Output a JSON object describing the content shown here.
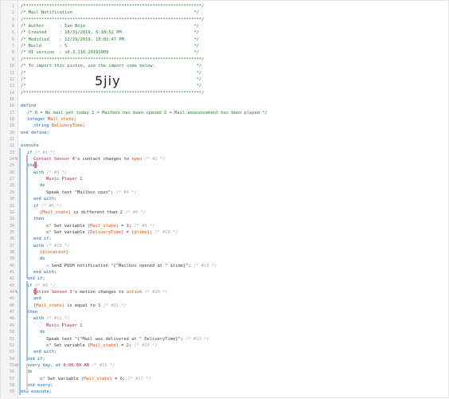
{
  "lines": [
    {
      "n": "1",
      "t": "/*********************************************************************/",
      "c": "cmt",
      "i": 0
    },
    {
      "n": "2",
      "t": "/* Mail Notification                                               */",
      "c": "cmt",
      "i": 0
    },
    {
      "n": "3",
      "t": "/*********************************************************************/",
      "c": "cmt",
      "i": 0
    },
    {
      "n": "4",
      "t": "/* Author      : Ian Boje                                          */",
      "c": "cmt",
      "i": 0
    },
    {
      "n": "5",
      "t": "/* Created     : 10/31/2019, 6:10:52 PM                            */",
      "c": "cmt",
      "i": 0
    },
    {
      "n": "6",
      "t": "/* Modified    : 12/29/2019, 10:02:47 PM                           */",
      "c": "cmt",
      "i": 0
    },
    {
      "n": "7",
      "t": "/* Build       : 5                                                 */",
      "c": "cmt",
      "i": 0
    },
    {
      "n": "8",
      "t": "/* UI version  : v0.3.110.20191009                                 */",
      "c": "cmt",
      "i": 0
    },
    {
      "n": "9",
      "t": "/*********************************************************************/",
      "c": "cmt",
      "i": 0
    },
    {
      "n": "10",
      "t": "/* To import this piston, use the import code below:                */",
      "c": "cmt",
      "i": 0
    },
    {
      "n": "11",
      "t": "/*                                                                  */",
      "c": "cmt",
      "i": 0
    },
    {
      "n": "12",
      "t": "/*                                                                  */",
      "c": "cmt",
      "i": 0
    },
    {
      "n": "13",
      "t": "/*                                                                  */",
      "c": "cmt",
      "i": 0
    },
    {
      "n": "14",
      "t": "/*********************************************************************/",
      "c": "cmt",
      "i": 0
    },
    {
      "n": "15",
      "t": "",
      "c": "",
      "i": 0
    },
    {
      "n": "16",
      "t": "define",
      "c": "kw",
      "i": 0
    },
    {
      "n": "17",
      "t": "/* 0 = No mail yet today 1 = Mailbox has been opened 2 = Mail announcement has been played */",
      "c": "cmt",
      "i": 1
    },
    {
      "n": "18",
      "segs": [
        {
          "t": "integer ",
          "c": "kw"
        },
        {
          "t": "Mail_state",
          "c": "var"
        },
        {
          "t": ";",
          "c": ""
        }
      ],
      "i": 1
    },
    {
      "n": "19",
      "segs": [
        {
          "t": "string ",
          "c": "kw"
        },
        {
          "t": "DeliveryTime",
          "c": "var"
        },
        {
          "t": ";",
          "c": ""
        }
      ],
      "i": 2
    },
    {
      "n": "20",
      "t": "end define;",
      "c": "kw",
      "i": 0
    },
    {
      "n": "21",
      "t": "",
      "c": "",
      "i": 0
    },
    {
      "n": "22",
      "t": "execute",
      "c": "kw",
      "i": 0
    },
    {
      "n": "23",
      "segs": [
        {
          "t": "if ",
          "c": "kw"
        },
        {
          "t": "/* #1 */",
          "c": "dim"
        }
      ],
      "i": 1
    },
    {
      "n": "24",
      "segs": [
        {
          "t": "Contact Sensor 4",
          "c": "dev"
        },
        {
          "t": "'s contact changes to ",
          "c": ""
        },
        {
          "t": "open",
          "c": "var"
        },
        {
          "t": " /* #2 */",
          "c": "dim"
        }
      ],
      "i": 2,
      "mark": "%"
    },
    {
      "n": "25",
      "t": "then",
      "c": "kw",
      "i": 1
    },
    {
      "n": "26",
      "segs": [
        {
          "t": "with ",
          "c": "kw"
        },
        {
          "t": "/* #3 */",
          "c": "dim"
        }
      ],
      "i": 2
    },
    {
      "n": "27",
      "segs": [
        {
          "t": "Music Player 1",
          "c": "dev"
        }
      ],
      "i": 4
    },
    {
      "n": "28",
      "t": "do",
      "c": "kw",
      "i": 3
    },
    {
      "n": "29",
      "segs": [
        {
          "t": "Speak text \"",
          "c": ""
        },
        {
          "t": "Mailbox open",
          "c": "str"
        },
        {
          "t": "\"; ",
          "c": ""
        },
        {
          "t": "/* #4 */",
          "c": "dim"
        }
      ],
      "i": 4
    },
    {
      "n": "30",
      "t": "end with;",
      "c": "kw",
      "i": 2
    },
    {
      "n": "31",
      "segs": [
        {
          "t": "if ",
          "c": "kw"
        },
        {
          "t": "/* #5 */",
          "c": "dim"
        }
      ],
      "i": 2
    },
    {
      "n": "32",
      "segs": [
        {
          "t": "{Mail_state}",
          "c": "var"
        },
        {
          "t": " is different than ",
          "c": ""
        },
        {
          "t": "2",
          "c": "num"
        },
        {
          "t": " /* #6 */",
          "c": "dim"
        }
      ],
      "i": 3
    },
    {
      "n": "33",
      "t": "then",
      "c": "kw",
      "i": 2
    },
    {
      "n": "34",
      "segs": [
        {
          "t": "x³ ",
          "c": "icon"
        },
        {
          "t": "Set variable ",
          "c": ""
        },
        {
          "t": "{Mail_state}",
          "c": "var"
        },
        {
          "t": " = ",
          "c": ""
        },
        {
          "t": "1",
          "c": "num"
        },
        {
          "t": "; ",
          "c": ""
        },
        {
          "t": "/* #9 */",
          "c": "dim"
        }
      ],
      "i": 4
    },
    {
      "n": "35",
      "segs": [
        {
          "t": "x³ ",
          "c": "icon"
        },
        {
          "t": "Set variable ",
          "c": ""
        },
        {
          "t": "{DeliveryTime}",
          "c": "var"
        },
        {
          "t": " = ",
          "c": ""
        },
        {
          "t": "{$time}",
          "c": "var"
        },
        {
          "t": "; ",
          "c": ""
        },
        {
          "t": "/* #20 */",
          "c": "dim"
        }
      ],
      "i": 4
    },
    {
      "n": "36",
      "t": "end if;",
      "c": "kw",
      "i": 2
    },
    {
      "n": "37",
      "segs": [
        {
          "t": "with ",
          "c": "kw"
        },
        {
          "t": "/* #10 */",
          "c": "dim"
        }
      ],
      "i": 2
    },
    {
      "n": "38",
      "segs": [
        {
          "t": "{$location}",
          "c": "var"
        }
      ],
      "i": 3
    },
    {
      "n": "39",
      "t": "do",
      "c": "kw",
      "i": 3
    },
    {
      "n": "40",
      "segs": [
        {
          "t": "▭ ",
          "c": "icon"
        },
        {
          "t": "Send PUSH notification \"",
          "c": ""
        },
        {
          "t": "{\"Mailbox opened at \" $time}",
          "c": "str"
        },
        {
          "t": "\"; ",
          "c": ""
        },
        {
          "t": "/* #19 */",
          "c": "dim"
        }
      ],
      "i": 4
    },
    {
      "n": "41",
      "t": "end with;",
      "c": "kw",
      "i": 2
    },
    {
      "n": "42",
      "t": "end if;",
      "c": "kw",
      "i": 1
    },
    {
      "n": "43",
      "segs": [
        {
          "t": "if ",
          "c": "kw"
        },
        {
          "t": "/* #9 */",
          "c": "dim"
        }
      ],
      "i": 1
    },
    {
      "n": "44",
      "segs": [
        {
          "t": "Motion Sensor 3",
          "c": "dev"
        },
        {
          "t": "'s motion changes to ",
          "c": ""
        },
        {
          "t": "active",
          "c": "var"
        },
        {
          "t": " /* #10 */",
          "c": "dim"
        }
      ],
      "i": 2,
      "mark": "%"
    },
    {
      "n": "45",
      "t": "and",
      "c": "kw",
      "i": 2
    },
    {
      "n": "46",
      "segs": [
        {
          "t": "{Mail_state}",
          "c": "var"
        },
        {
          "t": " is equal to ",
          "c": ""
        },
        {
          "t": "1",
          "c": "num"
        },
        {
          "t": " /* #11 */",
          "c": "dim"
        }
      ],
      "i": 2
    },
    {
      "n": "47",
      "t": "then",
      "c": "kw",
      "i": 1
    },
    {
      "n": "48",
      "segs": [
        {
          "t": "with ",
          "c": "kw"
        },
        {
          "t": "/* #12 */",
          "c": "dim"
        }
      ],
      "i": 2
    },
    {
      "n": "49",
      "segs": [
        {
          "t": "Music Player 1",
          "c": "dev"
        }
      ],
      "i": 4
    },
    {
      "n": "50",
      "t": "do",
      "c": "kw",
      "i": 3
    },
    {
      "n": "51",
      "segs": [
        {
          "t": "Speak text \"",
          "c": ""
        },
        {
          "t": "{\"Mail was delivered at \" DeliveryTime}",
          "c": "str"
        },
        {
          "t": "\"; ",
          "c": ""
        },
        {
          "t": "/* #13 */",
          "c": "dim"
        }
      ],
      "i": 4
    },
    {
      "n": "52",
      "segs": [
        {
          "t": "x³ ",
          "c": "icon"
        },
        {
          "t": "Set variable ",
          "c": ""
        },
        {
          "t": "{Mail_state}",
          "c": "var"
        },
        {
          "t": " = ",
          "c": ""
        },
        {
          "t": "2",
          "c": "num"
        },
        {
          "t": "; ",
          "c": ""
        },
        {
          "t": "/* #14 */",
          "c": "dim"
        }
      ],
      "i": 4
    },
    {
      "n": "53",
      "t": "end with;",
      "c": "kw",
      "i": 2
    },
    {
      "n": "54",
      "t": "end if;",
      "c": "kw",
      "i": 1
    },
    {
      "n": "55",
      "segs": [
        {
          "t": "every day, at ",
          "c": "kw"
        },
        {
          "t": "6:00:00 AM",
          "c": "num"
        },
        {
          "t": " /* #15 */",
          "c": "dim"
        }
      ],
      "i": 1,
      "mark": "⟳"
    },
    {
      "n": "56",
      "t": "do",
      "c": "kw",
      "i": 1
    },
    {
      "n": "57",
      "segs": [
        {
          "t": "x³ ",
          "c": "icon"
        },
        {
          "t": "Set variable ",
          "c": ""
        },
        {
          "t": "{Mail_state}",
          "c": "var"
        },
        {
          "t": " = ",
          "c": ""
        },
        {
          "t": "0",
          "c": "num"
        },
        {
          "t": "; ",
          "c": ""
        },
        {
          "t": "/* #17 */",
          "c": "dim"
        }
      ],
      "i": 3
    },
    {
      "n": "58",
      "t": "end every;",
      "c": "kw",
      "i": 1
    },
    {
      "n": "59",
      "t": "end execute;",
      "c": "kw",
      "i": 0
    }
  ],
  "import_code": "5jiy"
}
